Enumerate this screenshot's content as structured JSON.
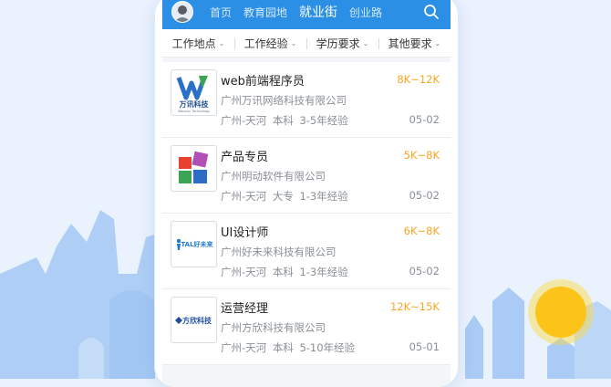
{
  "header": {
    "nav": [
      "首页",
      "教育园地",
      "就业街",
      "创业路"
    ],
    "active_index": 2
  },
  "filters": [
    "工作地点",
    "工作经验",
    "学历要求",
    "其他要求"
  ],
  "jobs": [
    {
      "title": "web前端程序员",
      "salary": "8K~12K",
      "company": "广州万讯网络科技有限公司",
      "location": "广州-天河",
      "education": "本科",
      "experience": "3-5年经验",
      "date": "05-02",
      "logo_text": "万讯科技",
      "logo_sub": "Wanxun Technology"
    },
    {
      "title": "产品专员",
      "salary": "5K~8K",
      "company": "广州明动软件有限公司",
      "location": "广州-天河",
      "education": "大专",
      "experience": "1-3年经验",
      "date": "05-02"
    },
    {
      "title": "UI设计师",
      "salary": "6K~8K",
      "company": "广州好未来科技有限公司",
      "location": "广州-天河",
      "education": "本科",
      "experience": "1-3年经验",
      "date": "05-02",
      "logo_text": "TAL好未来"
    },
    {
      "title": "运营经理",
      "salary": "12K~15K",
      "company": "广州方欣科技有限公司",
      "location": "广州-天河",
      "education": "本科",
      "experience": "5-10年经验",
      "date": "05-01",
      "logo_text": "方欣科技"
    }
  ],
  "colors": {
    "brand": "#2b8fe6",
    "salary": "#f5a623"
  }
}
